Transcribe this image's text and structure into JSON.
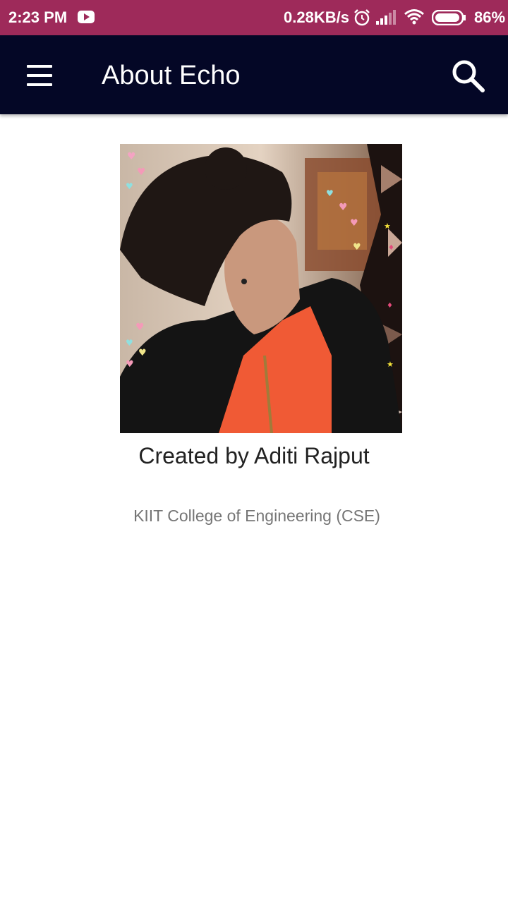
{
  "status_bar": {
    "time": "2:23 PM",
    "network_speed": "0.28KB/s",
    "battery_percent": "86%",
    "background_color": "#9e2a5a",
    "icons": [
      "youtube-icon",
      "alarm-icon",
      "signal-icon",
      "wifi-icon",
      "battery-icon"
    ]
  },
  "app_bar": {
    "title": "About Echo",
    "background_color": "#040726",
    "icons": [
      "menu-icon",
      "search-icon"
    ]
  },
  "profile": {
    "created_by": "Created by Aditi Rajput",
    "college": "KIIT College of Engineering (CSE)"
  }
}
